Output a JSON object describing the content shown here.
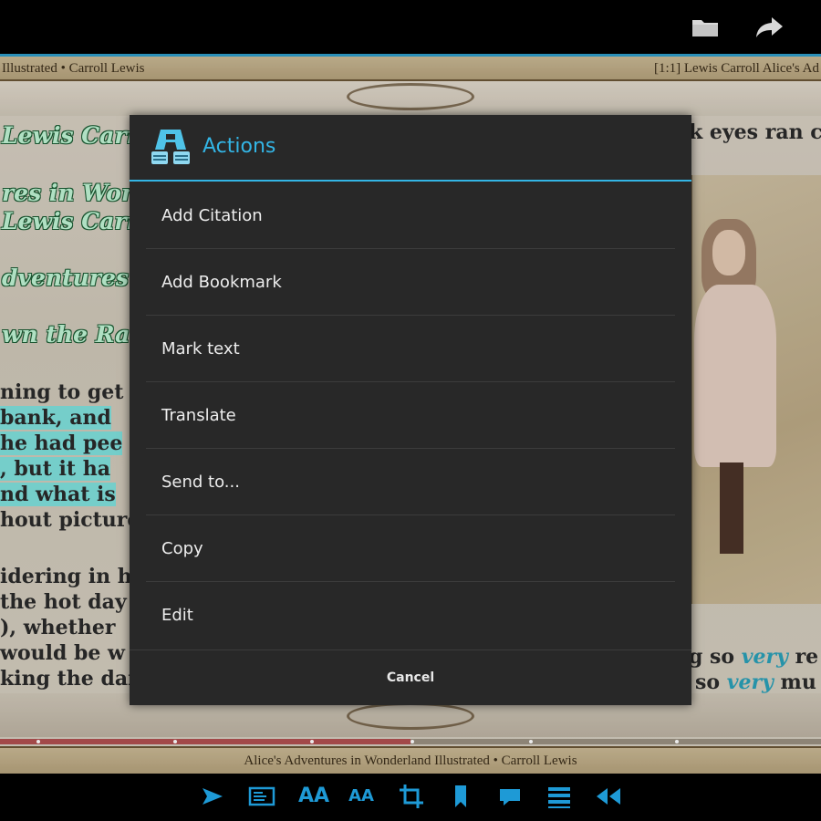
{
  "header": {
    "icons": [
      "folder-icon",
      "share-icon"
    ]
  },
  "book": {
    "running_head_left": "Illustrated • Carroll Lewis",
    "running_head_right": "[1:1] Lewis Carroll Alice's Ad",
    "running_foot": "Alice's Adventures in Wonderland Illustrated • Carroll Lewis",
    "progress_fraction": 0.5,
    "left_headings": [
      "Lewis Carr",
      "res in Wond",
      "Lewis Carr",
      "dventures in",
      "wn the Rab"
    ],
    "left_body_lines": [
      {
        "text": "ning to get v",
        "highlight": false
      },
      {
        "text": "bank, and",
        "highlight": true
      },
      {
        "text": "he had pee",
        "highlight": true
      },
      {
        "text": ", but it ha",
        "highlight": true
      },
      {
        "text": "nd what is",
        "highlight": true
      },
      {
        "text": "hout picture",
        "highlight": false
      },
      {
        "text": "idering in h",
        "highlight": false
      },
      {
        "text": "the hot day",
        "highlight": false
      },
      {
        "text": "), whether",
        "highlight": false
      },
      {
        "text": "would be w",
        "highlight": false
      },
      {
        "text": "king the dais",
        "highlight": false
      }
    ],
    "right_top_line": "k eyes ran c",
    "right_bottom_lines": [
      {
        "prefix": "g so ",
        "em": "very",
        "suffix": " re"
      },
      {
        "prefix": "so ",
        "em": "very",
        "suffix": " mu"
      }
    ],
    "highlight_color": "#7fe0dc",
    "emphasis_color": "#2aa0b8"
  },
  "dialog": {
    "title": "Actions",
    "app_icon": "reader-app-icon",
    "accent_color": "#33b5e5",
    "items": [
      {
        "label": "Add Citation"
      },
      {
        "label": "Add Bookmark"
      },
      {
        "label": "Mark text"
      },
      {
        "label": "Translate"
      },
      {
        "label": "Send to..."
      },
      {
        "label": "Copy"
      },
      {
        "label": "Edit"
      }
    ],
    "cancel_label": "Cancel"
  },
  "toolbar": {
    "accent_color": "#1e9ad6",
    "tools": [
      {
        "name": "goto-icon",
        "glyph": ""
      },
      {
        "name": "page-view-icon",
        "glyph": ""
      },
      {
        "name": "font-larger-icon",
        "glyph": "AA"
      },
      {
        "name": "font-smaller-icon",
        "glyph": "AA"
      },
      {
        "name": "crop-icon",
        "glyph": ""
      },
      {
        "name": "bookmark-icon",
        "glyph": ""
      },
      {
        "name": "comment-icon",
        "glyph": ""
      },
      {
        "name": "contents-icon",
        "glyph": ""
      },
      {
        "name": "rewind-icon",
        "glyph": ""
      }
    ]
  }
}
